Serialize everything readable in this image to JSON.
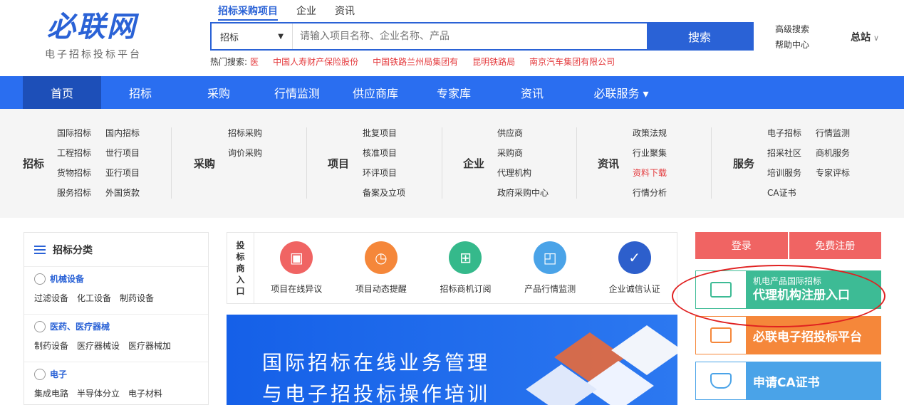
{
  "logo": {
    "main": "必联网",
    "sub": "电子招标投标平台"
  },
  "search": {
    "tabs": [
      "招标采购项目",
      "企业",
      "资讯"
    ],
    "select": "招标",
    "placeholder": "请输入项目名称、企业名称、产品",
    "button": "搜索",
    "hot_label": "热门搜索:",
    "hot": [
      "医",
      "中国人寿财产保险股份",
      "中国铁路兰州局集团有",
      "昆明铁路局",
      "南京汽车集团有限公司"
    ]
  },
  "header_links": {
    "advanced": "高级搜索",
    "help": "帮助中心",
    "station": "总站"
  },
  "nav": [
    "首页",
    "招标",
    "采购",
    "行情监测",
    "供应商库",
    "专家库",
    "资讯",
    "必联服务 ▾"
  ],
  "mega": [
    {
      "title": "招标",
      "rows": [
        [
          "国际招标",
          "国内招标"
        ],
        [
          "工程招标",
          "世行项目"
        ],
        [
          "货物招标",
          "亚行项目"
        ],
        [
          "服务招标",
          "外国货款"
        ]
      ]
    },
    {
      "title": "采购",
      "rows": [
        [
          "招标采购"
        ],
        [
          "询价采购"
        ]
      ]
    },
    {
      "title": "项目",
      "rows": [
        [
          "批复项目"
        ],
        [
          "核准项目"
        ],
        [
          "环评项目"
        ],
        [
          "备案及立项"
        ]
      ]
    },
    {
      "title": "企业",
      "rows": [
        [
          "供应商"
        ],
        [
          "采购商"
        ],
        [
          "代理机构"
        ],
        [
          "政府采购中心"
        ]
      ]
    },
    {
      "title": "资讯",
      "rows": [
        [
          "政策法规"
        ],
        [
          "行业聚集"
        ],
        [
          "资料下载"
        ],
        [
          "行情分析"
        ]
      ]
    },
    {
      "title": "服务",
      "rows": [
        [
          "电子招标",
          "行情监测"
        ],
        [
          "招采社区",
          "商机服务"
        ],
        [
          "培训服务",
          "专家评标"
        ],
        [
          "CA证书"
        ]
      ]
    }
  ],
  "sidebar": {
    "title": "招标分类",
    "cats": [
      {
        "name": "机械设备",
        "items": [
          "过滤设备",
          "化工设备",
          "制药设备"
        ]
      },
      {
        "name": "医药、医疗器械",
        "items": [
          "制药设备",
          "医疗器械设",
          "医疗器械加"
        ]
      },
      {
        "name": "电子",
        "items": [
          "集成电路",
          "半导体分立",
          "电子材料"
        ]
      }
    ]
  },
  "bidder": {
    "label": [
      "投",
      "标",
      "商",
      "入",
      "口"
    ],
    "items": [
      {
        "label": "项目在线异议",
        "color": "#f06463",
        "glyph": "▣"
      },
      {
        "label": "项目动态提醒",
        "color": "#f5873a",
        "glyph": "◷"
      },
      {
        "label": "招标商机订阅",
        "color": "#35b98b",
        "glyph": "⊞"
      },
      {
        "label": "产品行情监测",
        "color": "#4aa3e8",
        "glyph": "◰"
      },
      {
        "label": "企业诚信认证",
        "color": "#2d5fcc",
        "glyph": "✓"
      }
    ]
  },
  "banner": {
    "line1": "国际招标在线业务管理",
    "line2": "与电子招投标操作培训"
  },
  "auth": {
    "login": "登录",
    "register": "免费注册"
  },
  "cards": {
    "agent": {
      "line1": "机电产品国际招标",
      "line2": "代理机构注册入口",
      "color": "#3dbb95"
    },
    "platform": {
      "text": "必联电子招投标平台",
      "color": "#f5873a"
    },
    "ca": {
      "text": "申请CA证书",
      "color": "#4aa3e8"
    }
  }
}
